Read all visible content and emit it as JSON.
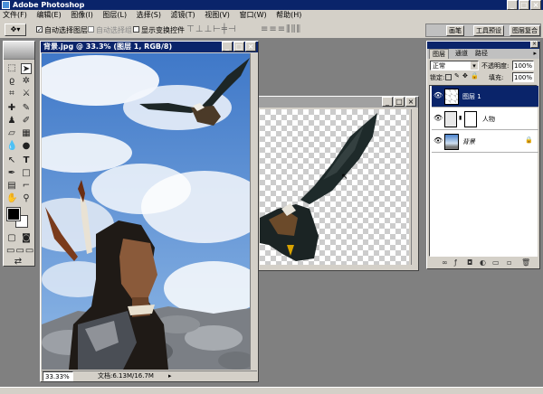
{
  "app": {
    "title": "Adobe Photoshop"
  },
  "menu": [
    "文件(F)",
    "编辑(E)",
    "图像(I)",
    "图层(L)",
    "选择(S)",
    "滤镜(T)",
    "视图(V)",
    "窗口(W)",
    "帮助(H)"
  ],
  "options_bar": {
    "auto_select_layer": "自动选择图层",
    "auto_select_group": "自动选择组",
    "show_transform": "显示变换控件"
  },
  "palette_well_tabs": [
    "画笔",
    "工具预设",
    "图层复合"
  ],
  "doc1": {
    "title": "背景.jpg @ 33.3% (图层 1, RGB/8)",
    "zoom": "33.33%",
    "doc_size": "文档:6.13M/16.7M"
  },
  "layers_panel": {
    "tabs": [
      "图层",
      "通道",
      "路径"
    ],
    "blend_mode": "正常",
    "opacity_label": "不透明度:",
    "opacity_value": "100%",
    "lock_label": "锁定:",
    "fill_label": "填充:",
    "fill_value": "100%",
    "layers": [
      {
        "name": "图层 1",
        "selected": true
      },
      {
        "name": "人物",
        "selected": false
      },
      {
        "name": "背景",
        "selected": false
      }
    ]
  }
}
